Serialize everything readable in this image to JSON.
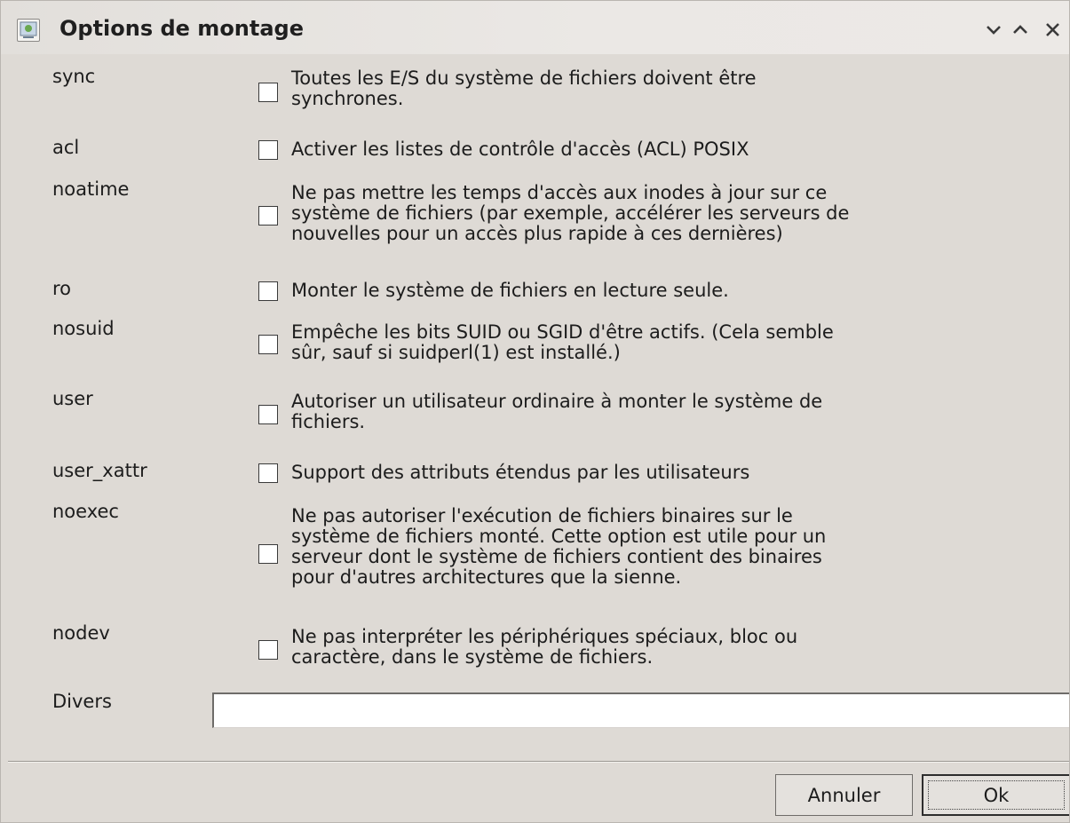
{
  "window": {
    "title": "Options de montage",
    "buttons": {
      "minimize": "minimize-icon",
      "maximize": "maximize-icon",
      "close": "close-icon"
    }
  },
  "options": [
    {
      "name": "sync",
      "checked": false,
      "description": [
        "Toutes les E/S du système de fichiers doivent être",
        "synchrones."
      ]
    },
    {
      "name": "acl",
      "checked": false,
      "description": [
        "Activer les listes de contrôle d'accès (ACL) POSIX"
      ]
    },
    {
      "name": "noatime",
      "checked": false,
      "description": [
        "Ne pas mettre les temps d'accès aux inodes à jour sur ce",
        "système de fichiers (par exemple, accélérer les serveurs de",
        "nouvelles pour un accès plus rapide à ces dernières)"
      ]
    },
    {
      "name": "ro",
      "checked": false,
      "description": [
        "Monter le système de fichiers en lecture seule."
      ]
    },
    {
      "name": "nosuid",
      "checked": false,
      "description": [
        "Empêche les bits SUID ou SGID d'être actifs. (Cela semble",
        "sûr, sauf si suidperl(1) est installé.)"
      ]
    },
    {
      "name": "user",
      "checked": false,
      "description": [
        "Autoriser un utilisateur ordinaire à monter le système de",
        "fichiers."
      ]
    },
    {
      "name": "user_xattr",
      "checked": false,
      "description": [
        "Support des attributs étendus par les utilisateurs"
      ]
    },
    {
      "name": "noexec",
      "checked": false,
      "description": [
        "Ne pas autoriser l'exécution de fichiers binaires sur le",
        "système de fichiers monté. Cette option est utile pour un",
        "serveur dont le système de fichiers contient des binaires",
        "pour d'autres architectures que la sienne."
      ]
    },
    {
      "name": "nodev",
      "checked": false,
      "description": [
        "Ne pas interpréter les périphériques spéciaux, bloc ou",
        "caractère, dans le système de fichiers."
      ]
    }
  ],
  "misc": {
    "label": "Divers",
    "value": "",
    "placeholder": ""
  },
  "dialog_buttons": {
    "cancel": "Annuler",
    "ok": "Ok"
  }
}
